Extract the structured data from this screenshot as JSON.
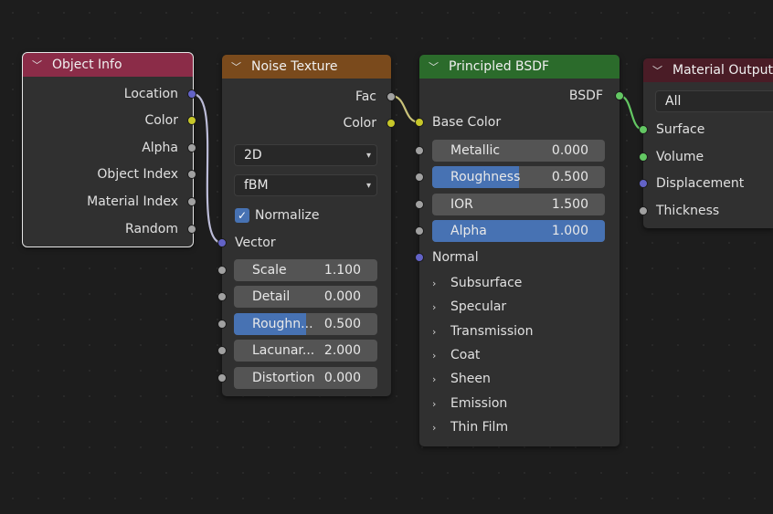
{
  "colors": {
    "object_info_header": "#8b2c48",
    "noise_header": "#7a4a1c",
    "principled_header": "#2b6b2b",
    "output_header": "#4a1c26",
    "slider_fill": "#4772b3"
  },
  "object_info": {
    "title": "Object Info",
    "outputs": [
      "Location",
      "Color",
      "Alpha",
      "Object Index",
      "Material Index",
      "Random"
    ]
  },
  "noise": {
    "title": "Noise Texture",
    "outputs": [
      "Fac",
      "Color"
    ],
    "dimensions": "2D",
    "type": "fBM",
    "normalize_label": "Normalize",
    "normalize_checked": true,
    "vector_label": "Vector",
    "fields": [
      {
        "label": "Scale",
        "value": "1.100"
      },
      {
        "label": "Detail",
        "value": "0.000"
      },
      {
        "label": "Roughn...",
        "value": "0.500",
        "fill": 0.5
      },
      {
        "label": "Lacunar...",
        "value": "2.000"
      },
      {
        "label": "Distortion",
        "value": "0.000"
      }
    ]
  },
  "principled": {
    "title": "Principled BSDF",
    "output": "BSDF",
    "base_color": "Base Color",
    "fields": [
      {
        "label": "Metallic",
        "value": "0.000"
      },
      {
        "label": "Roughness",
        "value": "0.500",
        "fill": 0.5
      },
      {
        "label": "IOR",
        "value": "1.500"
      },
      {
        "label": "Alpha",
        "value": "1.000",
        "fill": 1.0
      }
    ],
    "normal": "Normal",
    "panels": [
      "Subsurface",
      "Specular",
      "Transmission",
      "Coat",
      "Sheen",
      "Emission",
      "Thin Film"
    ]
  },
  "output": {
    "title": "Material Output",
    "target": "All",
    "inputs": [
      "Surface",
      "Volume",
      "Displacement",
      "Thickness"
    ]
  }
}
